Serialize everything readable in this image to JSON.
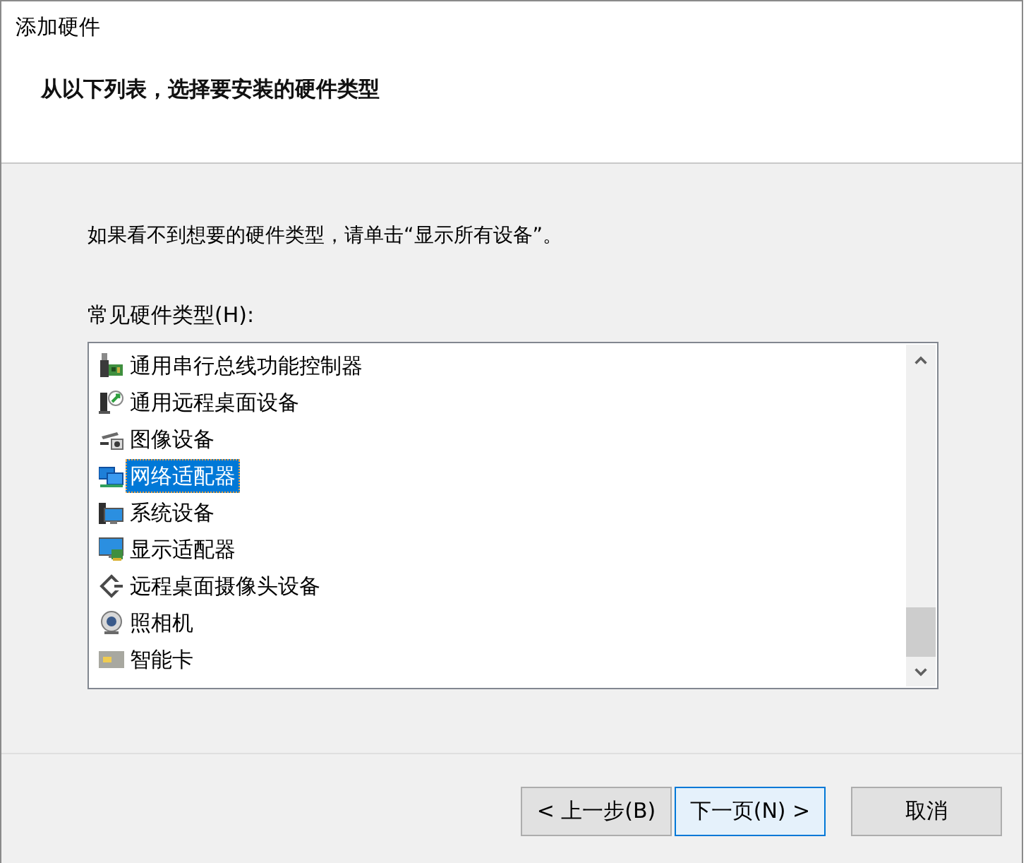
{
  "window": {
    "title": "添加硬件"
  },
  "header": {
    "heading": "从以下列表，选择要安装的硬件类型"
  },
  "instruction": "如果看不到想要的硬件类型，请单击“显示所有设备”。",
  "hardware_list": {
    "label": "常见硬件类型(H):",
    "items": [
      {
        "kind": "controller",
        "label": "通用串行总线功能控制器",
        "selected": false
      },
      {
        "kind": "remote",
        "label": "通用远程桌面设备",
        "selected": false
      },
      {
        "kind": "imaging",
        "label": "图像设备",
        "selected": false
      },
      {
        "kind": "network",
        "label": "网络适配器",
        "selected": true
      },
      {
        "kind": "system",
        "label": "系统设备",
        "selected": false
      },
      {
        "kind": "display",
        "label": "显示适配器",
        "selected": false
      },
      {
        "kind": "remotecam",
        "label": "远程桌面摄像头设备",
        "selected": false
      },
      {
        "kind": "webcam",
        "label": "照相机",
        "selected": false
      },
      {
        "kind": "smartcard",
        "label": "智能卡",
        "selected": false
      }
    ]
  },
  "buttons": [
    {
      "label": "< 上一步(B)",
      "default": false
    },
    {
      "label": "下一页(N) >",
      "default": true
    },
    {
      "label": "取消",
      "default": false
    }
  ]
}
